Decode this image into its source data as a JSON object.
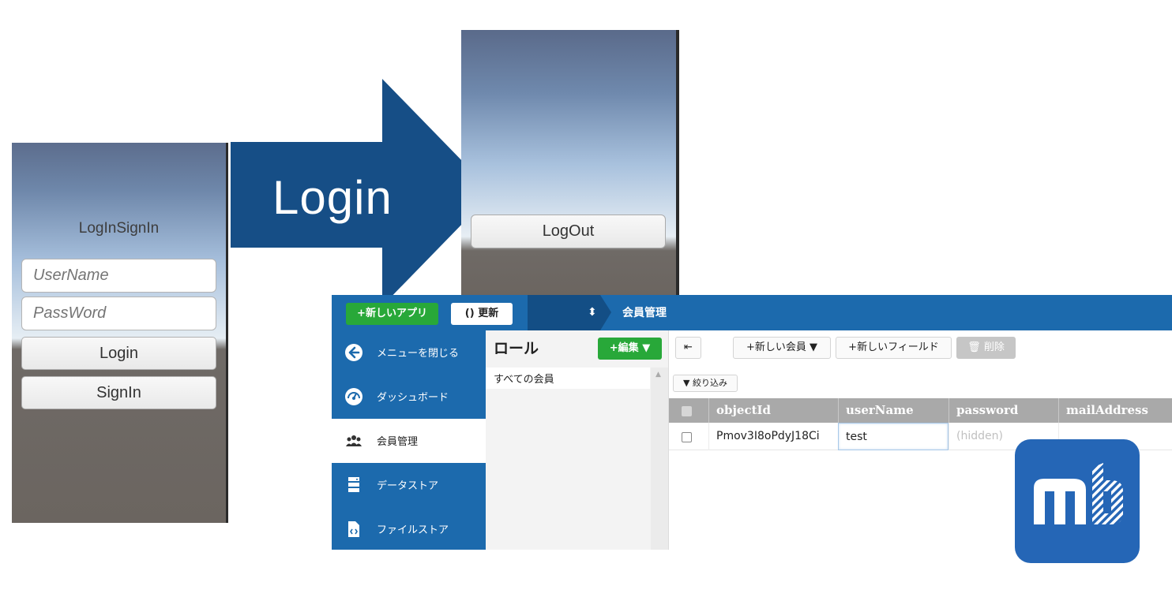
{
  "login_screen": {
    "title": "LogInSignIn",
    "username_placeholder": "UserName",
    "password_placeholder": "PassWord",
    "login_label": "Login",
    "signin_label": "SignIn"
  },
  "arrow": {
    "label": "Login"
  },
  "logout_screen": {
    "logout_label": "LogOut"
  },
  "console": {
    "topbar": {
      "new_app_label": "+新しいアプリ",
      "refresh_label": "更新",
      "breadcrumb": "会員管理"
    },
    "sidebar": {
      "items": [
        {
          "label": "メニューを閉じる",
          "icon": "arrow-left-circle-icon"
        },
        {
          "label": "ダッシュボード",
          "icon": "speedometer-icon"
        },
        {
          "label": "会員管理",
          "icon": "users-icon",
          "active": true
        },
        {
          "label": "データストア",
          "icon": "database-icon"
        },
        {
          "label": "ファイルストア",
          "icon": "file-code-icon"
        }
      ]
    },
    "roles": {
      "title": "ロール",
      "edit_label": "+編集 ▼",
      "all_members": "すべての会員"
    },
    "toolbar": {
      "new_member_label": "+新しい会員 ▼",
      "new_field_label": "+新しいフィールド",
      "delete_label": "削除",
      "filter_label": "絞り込み"
    },
    "grid": {
      "columns": [
        "objectId",
        "userName",
        "password",
        "mailAddress"
      ],
      "rows": [
        {
          "objectId": "Pmov3I8oPdyJ18Ci",
          "userName": "test",
          "password": "(hidden)",
          "mailAddress": ""
        }
      ]
    }
  },
  "colors": {
    "console_blue": "#1c6aad",
    "arrow_blue": "#164e86",
    "green": "#28a839",
    "logo_blue": "#2566b6"
  }
}
